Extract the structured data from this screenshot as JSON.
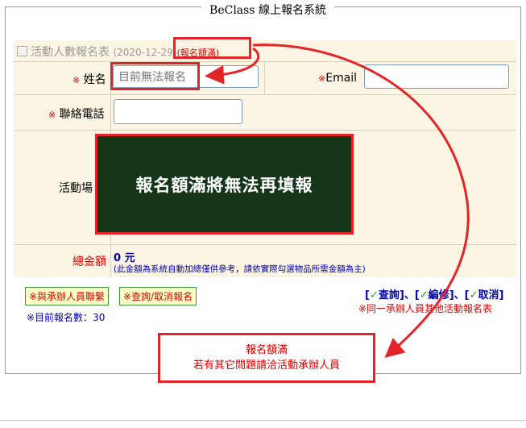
{
  "legend": "BeClass 線上報名系統",
  "form": {
    "title": "活動人數報名表",
    "date": "(2020-12-29)",
    "status": "(報名額滿)"
  },
  "fields": {
    "name": {
      "mark": "※",
      "label": "姓名",
      "placeholder": "目前無法報名"
    },
    "email": {
      "mark": "※",
      "label": "Email"
    },
    "phone": {
      "mark": "※",
      "label": "聯絡電話"
    },
    "venue": {
      "label": "活動場"
    },
    "total": {
      "label": "總金額",
      "amount": "0 元",
      "note": "(此金額為系統自動加總僅供參考，請依實際勾選物品所需金額為主)"
    }
  },
  "overlay": "報名額滿將無法再填報",
  "buttons": {
    "contact": "※與承辦人員聯繫",
    "query_cancel": "※查詢/取消報名"
  },
  "links": {
    "open": "[",
    "query": "查詢",
    "edit": "編修",
    "cancel": "取消",
    "close": "]",
    "sep": "]、[",
    "check": "✓",
    "others": "※同一承辦人員其他活動報名表"
  },
  "count": {
    "label": "※目前報名數：",
    "value": "30"
  },
  "message": {
    "line1": "報名額滿",
    "line2": "若有其它問題請洽活動承辦人員"
  },
  "colors": {
    "alert_red": "#e32428",
    "overlay_green": "#16361a",
    "form_bg": "#fdf5e3"
  }
}
